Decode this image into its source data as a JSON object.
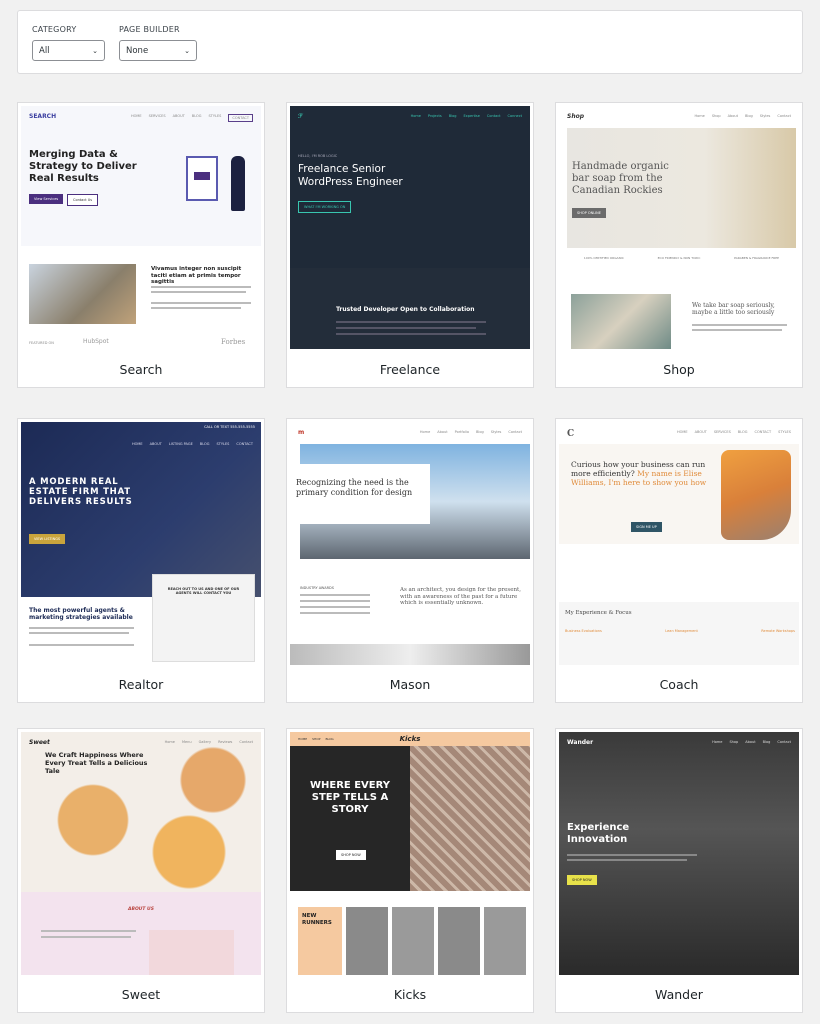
{
  "filters": {
    "category": {
      "label": "CATEGORY",
      "value": "All"
    },
    "page_builder": {
      "label": "PAGE BUILDER",
      "value": "None"
    }
  },
  "templates": [
    {
      "name": "Search",
      "logo": "SEARCH",
      "headline": "Merging Data & Strategy to Deliver Real Results",
      "sub": "Vivamus integer non suscipit taciti etiam at primis tempor sagittis",
      "btn1": "View Services",
      "btn2": "Contact Us",
      "nav": [
        "HOME",
        "SERVICES",
        "ABOUT",
        "BLOG",
        "STYLES",
        "CONTACT"
      ],
      "logos": [
        "FEATURED ON",
        "HubSpot",
        "Forbes"
      ]
    },
    {
      "name": "Freelance",
      "headline": "Freelance Senior WordPress Engineer",
      "tag": "HELLO, I'M ROB LOGIC",
      "btn1": "WHAT I'M WORKING ON",
      "sub": "Trusted Developer Open to Collaboration",
      "nav": [
        "Home",
        "Projects",
        "Blog",
        "Expertise",
        "Contact",
        "Connect"
      ]
    },
    {
      "name": "Shop",
      "logo": "Shop",
      "headline": "Handmade organic bar soap from the Canadian Rockies",
      "btn1": "SHOP ONLINE",
      "sub": "We take bar soap seriously, maybe a little too seriously",
      "features": [
        "100% CERTIFIED ORGANIC",
        "ECO FRIENDLY & NON TOXIC",
        "PARABEN & FRAGRANCE FREE"
      ],
      "nav": [
        "Home",
        "Shop",
        "About",
        "Blog",
        "Styles",
        "Contact"
      ]
    },
    {
      "name": "Realtor",
      "headline": "A MODERN REAL ESTATE FIRM THAT DELIVERS RESULTS",
      "topbar": "CALL OR TEXT 555-555-5555",
      "btn1": "VIEW LISTINGS",
      "sub": "The most powerful agents & marketing strategies available",
      "form": "REACH OUT TO US AND ONE OF OUR AGENTS WILL CONTACT YOU",
      "nav": [
        "HOME",
        "ABOUT",
        "LISTING PAGE",
        "BLOG",
        "STYLES",
        "CONTACT"
      ]
    },
    {
      "name": "Mason",
      "headline": "Recognizing the need is the primary condition for design",
      "sub": "As an architect, you design for the present, with an awareness of the past for a future which is essentially unknown.",
      "awards": "INDUSTRY AWARDS",
      "nav": [
        "Home",
        "About",
        "Portfolio",
        "Blog",
        "Styles",
        "Contact"
      ]
    },
    {
      "name": "Coach",
      "headline": "Curious how your business can run more efficiently?",
      "highlight": "My name is Elise Williams, I'm here to show you how",
      "btn1": "SIGN ME UP",
      "sub": "My Experience & Focus",
      "focus": [
        "Business Evaluations",
        "Lean Management",
        "Remote Workshops"
      ],
      "nav": [
        "HOME",
        "ABOUT",
        "SERVICES",
        "BLOG",
        "CONTACT",
        "STYLES"
      ]
    },
    {
      "name": "Sweet",
      "logo": "Sweet",
      "headline": "We Craft Happiness Where Every Treat Tells a Delicious Tale",
      "sub": "ABOUT US",
      "nav": [
        "Home",
        "Menu",
        "Gallery",
        "Reviews",
        "Contact"
      ]
    },
    {
      "name": "Kicks",
      "logo": "Kicks",
      "headline": "WHERE EVERY STEP TELLS A STORY",
      "btn1": "SHOP NOW",
      "sub": "NEW RUNNERS",
      "nav": [
        "HOME",
        "SHOP",
        "BLOG"
      ]
    },
    {
      "name": "Wander",
      "logo": "Wander",
      "headline": "Experience Innovation",
      "btn1": "SHOP NOW",
      "nav": [
        "Home",
        "Shop",
        "About",
        "Blog",
        "Contact"
      ]
    }
  ]
}
